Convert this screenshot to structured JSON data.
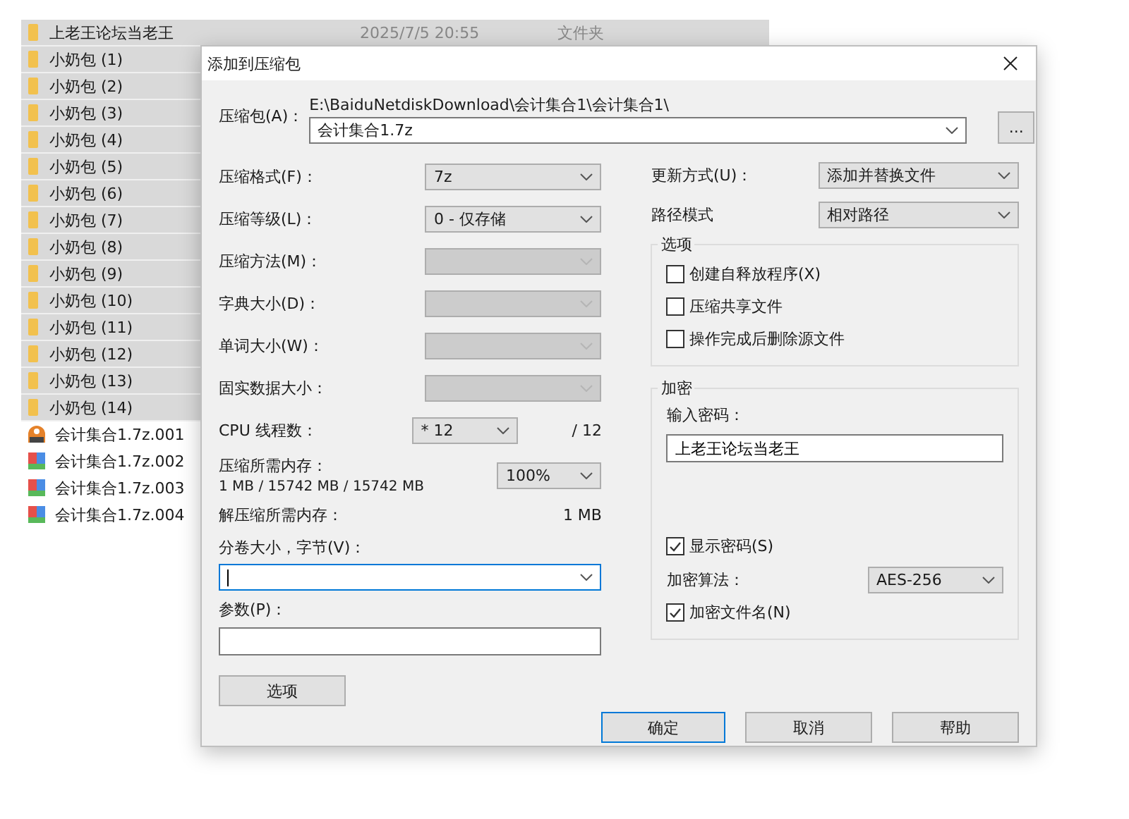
{
  "explorer": {
    "items": [
      {
        "kind": "folder",
        "name": "上老王论坛当老王",
        "date": "2025/7/5 20:55",
        "type": "文件夹",
        "selected": true
      },
      {
        "kind": "folder",
        "name": "小奶包 (1)",
        "selected": true
      },
      {
        "kind": "folder",
        "name": "小奶包 (2)",
        "selected": true
      },
      {
        "kind": "folder",
        "name": "小奶包 (3)",
        "selected": true
      },
      {
        "kind": "folder",
        "name": "小奶包 (4)",
        "selected": true
      },
      {
        "kind": "folder",
        "name": "小奶包 (5)",
        "selected": true
      },
      {
        "kind": "folder",
        "name": "小奶包 (6)",
        "selected": true
      },
      {
        "kind": "folder",
        "name": "小奶包 (7)",
        "selected": true
      },
      {
        "kind": "folder",
        "name": "小奶包 (8)",
        "selected": true
      },
      {
        "kind": "folder",
        "name": "小奶包 (9)",
        "selected": true
      },
      {
        "kind": "folder",
        "name": "小奶包 (10)",
        "selected": true
      },
      {
        "kind": "folder",
        "name": "小奶包 (11)",
        "selected": true
      },
      {
        "kind": "folder",
        "name": "小奶包 (12)",
        "selected": true
      },
      {
        "kind": "folder",
        "name": "小奶包 (13)",
        "selected": true
      },
      {
        "kind": "folder",
        "name": "小奶包 (14)",
        "selected": true
      },
      {
        "kind": "installer",
        "name": "会计集合1.7z.001",
        "selected": false
      },
      {
        "kind": "volume",
        "name": "会计集合1.7z.002",
        "selected": false
      },
      {
        "kind": "volume",
        "name": "会计集合1.7z.003",
        "selected": false
      },
      {
        "kind": "volume",
        "name": "会计集合1.7z.004",
        "selected": false
      }
    ]
  },
  "dialog": {
    "title": "添加到压缩包",
    "archive": {
      "label": "压缩包(A)：",
      "path": "E:\\BaiduNetdiskDownload\\会计集合1\\会计集合1\\",
      "value": "会计集合1.7z",
      "browse": "..."
    },
    "left_fields": [
      {
        "kind": "select",
        "label": "压缩格式(F)：",
        "value": "7z",
        "disabled": false
      },
      {
        "kind": "select",
        "label": "压缩等级(L)：",
        "value": "0 - 仅存储",
        "disabled": false
      },
      {
        "kind": "select",
        "label": "压缩方法(M)：",
        "disabled": true
      },
      {
        "kind": "select",
        "label": "字典大小(D)：",
        "disabled": true
      },
      {
        "kind": "select",
        "label": "单词大小(W)：",
        "disabled": true
      },
      {
        "kind": "select",
        "label": "固实数据大小：",
        "disabled": true
      },
      {
        "kind": "threads",
        "label": "CPU 线程数：",
        "value": "* 12",
        "total": "/ 12"
      },
      {
        "kind": "memory",
        "label": "压缩所需内存：",
        "detail": "1 MB / 15742 MB / 15742 MB",
        "value": "100%"
      },
      {
        "kind": "info",
        "label": "解压缩所需内存：",
        "value": "1 MB"
      }
    ],
    "volume": {
      "label": "分卷大小，字节(V)：",
      "focused": true
    },
    "params": {
      "label": "参数(P)："
    },
    "options_button": "选项",
    "right_fields": [
      {
        "label": "更新方式(U)：",
        "value": "添加并替换文件"
      },
      {
        "label": "路径模式",
        "value": "相对路径"
      }
    ],
    "options_group": {
      "title": "选项",
      "checkboxes": [
        {
          "label": "创建自释放程序(X)",
          "checked": false
        },
        {
          "label": "压缩共享文件",
          "checked": false
        },
        {
          "label": "操作完成后删除源文件",
          "checked": false
        }
      ]
    },
    "encryption": {
      "title": "加密",
      "password_label": "输入密码：",
      "password": "上老王论坛当老王",
      "show_password": {
        "label": "显示密码(S)",
        "checked": true
      },
      "method_label": "加密算法：",
      "method": "AES-256",
      "encrypt_names": {
        "label": "加密文件名(N)",
        "checked": true
      }
    },
    "buttons": [
      {
        "label": "确定",
        "default": true
      },
      {
        "label": "取消",
        "default": false
      },
      {
        "label": "帮助",
        "default": false
      }
    ]
  }
}
